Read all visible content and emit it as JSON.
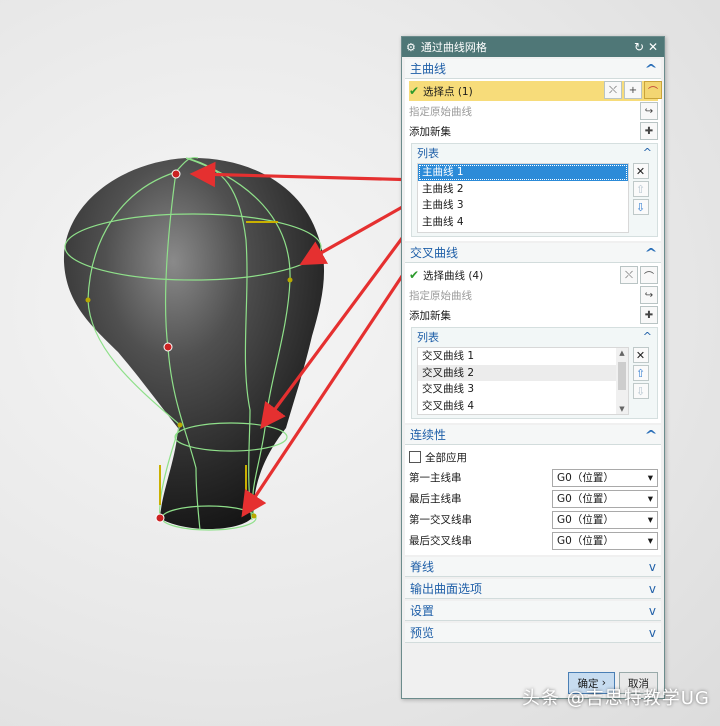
{
  "dialog": {
    "title": "通过曲线网格",
    "title_icon": "gear-icon",
    "reset_icon": "reset-icon",
    "close_icon": "close-icon"
  },
  "primary_curves": {
    "header": "主曲线",
    "select_label": "选择点 (1)",
    "specify_label": "指定原始曲线",
    "add_new_set": "添加新集",
    "list_header": "列表",
    "items": [
      "主曲线 1",
      "主曲线 2",
      "主曲线 3",
      "主曲线 4"
    ],
    "selected_index": 0
  },
  "cross_curves": {
    "header": "交叉曲线",
    "select_label": "选择曲线 (4)",
    "specify_label": "指定原始曲线",
    "add_new_set": "添加新集",
    "list_header": "列表",
    "items": [
      "交叉曲线 1",
      "交叉曲线 2",
      "交叉曲线 3",
      "交叉曲线 4"
    ]
  },
  "continuity": {
    "header": "连续性",
    "apply_all": "全部应用",
    "rows": [
      {
        "label": "第一主线串",
        "value": "G0（位置）"
      },
      {
        "label": "最后主线串",
        "value": "G0（位置）"
      },
      {
        "label": "第一交叉线串",
        "value": "G0（位置）"
      },
      {
        "label": "最后交叉线串",
        "value": "G0（位置）"
      }
    ]
  },
  "collapsed_sections": [
    "脊线",
    "输出曲面选项",
    "设置",
    "预览"
  ],
  "footer": {
    "ok": "确定",
    "cancel": "取消"
  },
  "watermark": "头条 @吉思特教学UG",
  "colors": {
    "title_bar": "#4f7777",
    "accent_blue": "#1f5fa8",
    "highlight": "#f7dc7a",
    "arrow_red": "#e53030",
    "curve_green": "#8fe08a"
  }
}
